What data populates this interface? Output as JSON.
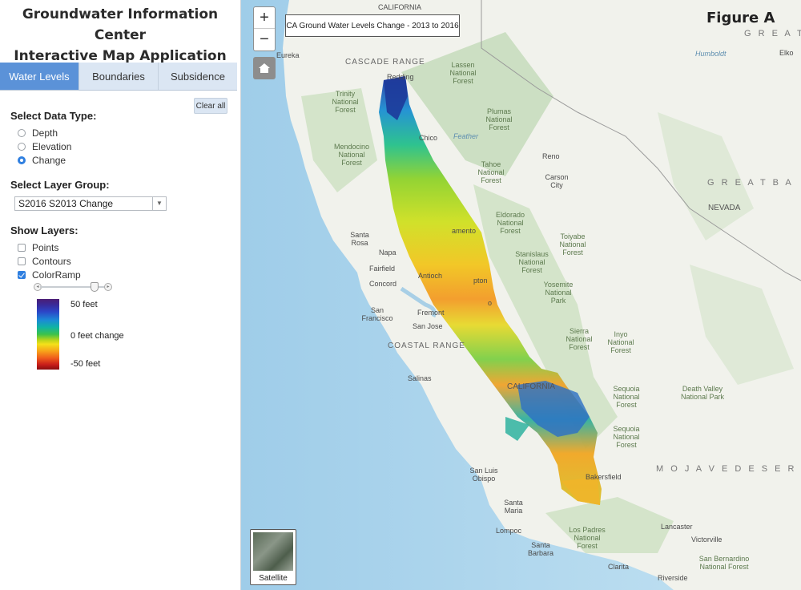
{
  "app": {
    "title_line1": "Groundwater Information Center",
    "title_line2": "Interactive Map Application"
  },
  "tabs": [
    {
      "label": "Water Levels",
      "active": true
    },
    {
      "label": "Boundaries",
      "active": false
    },
    {
      "label": "Subsidence",
      "active": false
    }
  ],
  "clear_all_label": "Clear all",
  "data_type": {
    "title": "Select Data Type:",
    "options": [
      {
        "label": "Depth",
        "selected": false
      },
      {
        "label": "Elevation",
        "selected": false
      },
      {
        "label": "Change",
        "selected": true
      }
    ]
  },
  "layer_group": {
    "title": "Select Layer Group:",
    "selected": "S2016 S2013 Change"
  },
  "layers": {
    "title": "Show Layers:",
    "items": [
      {
        "label": "Points",
        "checked": false
      },
      {
        "label": "Contours",
        "checked": false
      },
      {
        "label": "ColorRamp",
        "checked": true
      }
    ],
    "opacity": 0.85
  },
  "legend": {
    "top": "50 feet",
    "middle": "0 feet change",
    "bottom": "-50 feet"
  },
  "map": {
    "title_box": "CA Ground Water Levels Change - 2013 to 2016",
    "figure_label": "Figure A",
    "zoom_in": "+",
    "zoom_out": "−",
    "satellite_label": "Satellite",
    "labels": {
      "california_top": "CALIFORNIA",
      "great_top": "G R E A T",
      "humboldt": "Humboldt",
      "elko": "Elko",
      "eureka": "Eureka",
      "cascade": "CASCADE RANGE",
      "redding": "Redding",
      "lassen": "Lassen National Forest",
      "trinity": "Trinity National Forest",
      "plumas": "Plumas National Forest",
      "chico": "Chico",
      "feather": "Feather",
      "reno": "Reno",
      "carson": "Carson City",
      "mendocino": "Mendocino National Forest",
      "tahoe": "Tahoe National Forest",
      "great_basin": "G R E A T  B A",
      "nevada": "NEVADA",
      "eldorado": "Eldorado National Forest",
      "sacramento": "amento",
      "santa_rosa": "Santa Rosa",
      "napa": "Napa",
      "toiyabe": "Toiyabe National Forest",
      "stanislaus": "Stanislaus National Forest",
      "fairfield": "Fairfield",
      "concord": "Concord",
      "antioch": "Antioch",
      "stockton": "pton",
      "yosemite": "Yosemite National Park",
      "san_francisco": "San Francisco",
      "fremont": "Fremont",
      "modesto": "o",
      "san_jose": "San Jose",
      "coastal": "COASTAL RANGE",
      "sierra": "Sierra National Forest",
      "inyo": "Inyo National Forest",
      "salinas": "Salinas",
      "california_mid": "CALIFORNIA",
      "sequoia1": "Sequoia National Forest",
      "death_valley": "Death Valley National Park",
      "sequoia2": "Sequoia National Forest",
      "mojave": "M O J A V E  D E S E R T",
      "bakersfield": "Bakersfield",
      "san_luis": "San Luis Obispo",
      "santa_maria": "Santa Maria",
      "lompoc": "Lompoc",
      "lancaster": "Lancaster",
      "victorville": "Victorville",
      "los_padres": "Los Padres National Forest",
      "santa_barbara": "Santa Barbara",
      "san_bernardino": "San Bernardino National Forest",
      "riverside": "Riverside",
      "clarita": "Clarita"
    }
  }
}
